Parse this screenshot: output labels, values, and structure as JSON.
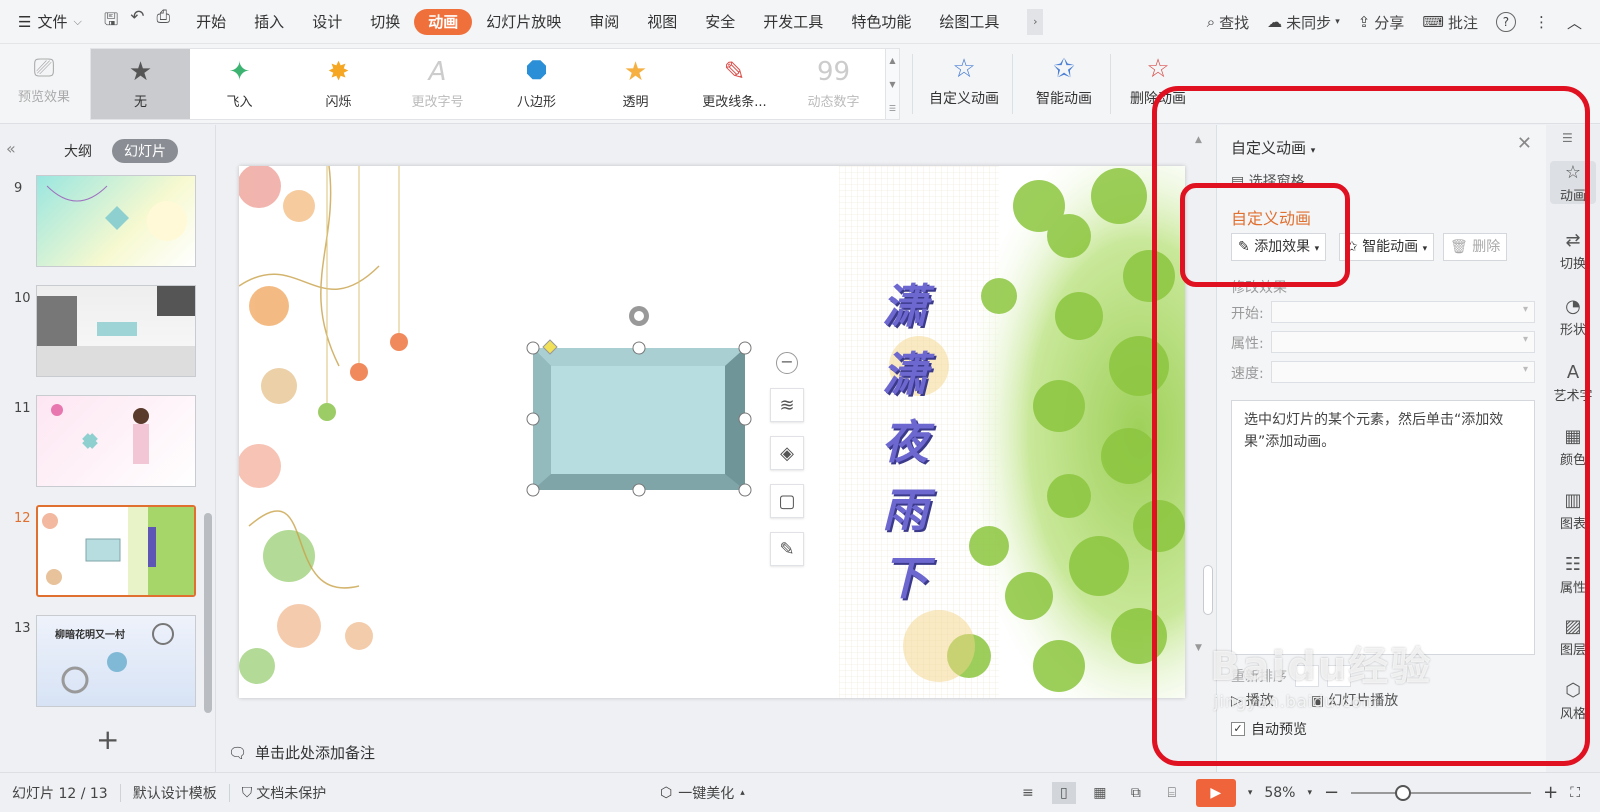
{
  "menu": {
    "file_label": "文件",
    "tabs": [
      {
        "label": "开始"
      },
      {
        "label": "插入"
      },
      {
        "label": "设计"
      },
      {
        "label": "切换"
      },
      {
        "label": "动画",
        "active": true
      },
      {
        "label": "幻灯片放映"
      },
      {
        "label": "审阅"
      },
      {
        "label": "视图"
      },
      {
        "label": "安全"
      },
      {
        "label": "开发工具"
      },
      {
        "label": "特色功能"
      },
      {
        "label": "绘图工具"
      }
    ],
    "search_label": "查找",
    "sync_label": "未同步",
    "share_label": "分享",
    "comment_label": "批注",
    "accent_color": "#f0703c"
  },
  "ribbon": {
    "preview_label": "预览效果",
    "effects": [
      {
        "label": "无",
        "icon": "star-gray-icon",
        "selected": true
      },
      {
        "label": "飞入",
        "icon": "fly-in-star-icon"
      },
      {
        "label": "闪烁",
        "icon": "flash-star-icon"
      },
      {
        "label": "更改字号",
        "icon": "font-size-icon",
        "disabled": true
      },
      {
        "label": "八边形",
        "icon": "octagon-icon"
      },
      {
        "label": "透明",
        "icon": "transparent-star-icon"
      },
      {
        "label": "更改线条...",
        "icon": "line-color-icon"
      },
      {
        "label": "动态数字",
        "icon": "dynamic-number-icon",
        "disabled": true
      }
    ],
    "custom_anim_label": "自定义动画",
    "smart_anim_label": "智能动画",
    "delete_anim_label": "删除动画"
  },
  "left_panel": {
    "tabs": [
      "大纲",
      "幻灯片"
    ],
    "active_tab": "幻灯片",
    "slides": [
      {
        "num": "9"
      },
      {
        "num": "10"
      },
      {
        "num": "11"
      },
      {
        "num": "12",
        "current": true
      },
      {
        "num": "13"
      }
    ],
    "thumb13_title": "柳暗花明又一村"
  },
  "slide": {
    "title_text": "潇潇夜雨下"
  },
  "notes_label": "单击此处添加备注",
  "task_pane": {
    "header": "自定义动画",
    "select_pane": "选择窗格",
    "section_title": "自定义动画",
    "add_effect": "添加效果",
    "smart_anim": "智能动画",
    "delete": "删除",
    "modify_title": "修改效果",
    "start_label": "开始:",
    "property_label": "属性:",
    "speed_label": "速度:",
    "list_hint": "选中幻灯片的某个元素，然后单击“添加效果”添加动画。",
    "reorder_label": "重新排序",
    "play_label": "播放",
    "slideshow_label": "幻灯片播放",
    "auto_preview": "自动预览",
    "auto_preview_checked": true
  },
  "side_toolbar": [
    {
      "label": "动画",
      "icon": "animation-icon",
      "active": true
    },
    {
      "label": "切换",
      "icon": "transition-icon"
    },
    {
      "label": "形状",
      "icon": "shape-icon"
    },
    {
      "label": "艺术字",
      "icon": "wordart-icon"
    },
    {
      "label": "颜色",
      "icon": "color-icon"
    },
    {
      "label": "图表",
      "icon": "chart-icon"
    },
    {
      "label": "属性",
      "icon": "property-icon"
    },
    {
      "label": "图层",
      "icon": "layer-icon"
    },
    {
      "label": "风格",
      "icon": "style-icon"
    }
  ],
  "status": {
    "slide_pos": "幻灯片 12 / 13",
    "template": "默认设计模板",
    "protect": "文档未保护",
    "beautify": "一键美化",
    "zoom": "58%",
    "zoom_fraction": 0.58,
    "play_color": "#f0643c"
  },
  "watermark": {
    "text": "Baidu经验",
    "sub": "jingyan.baidu.com"
  },
  "annotation_color": "#e01222"
}
